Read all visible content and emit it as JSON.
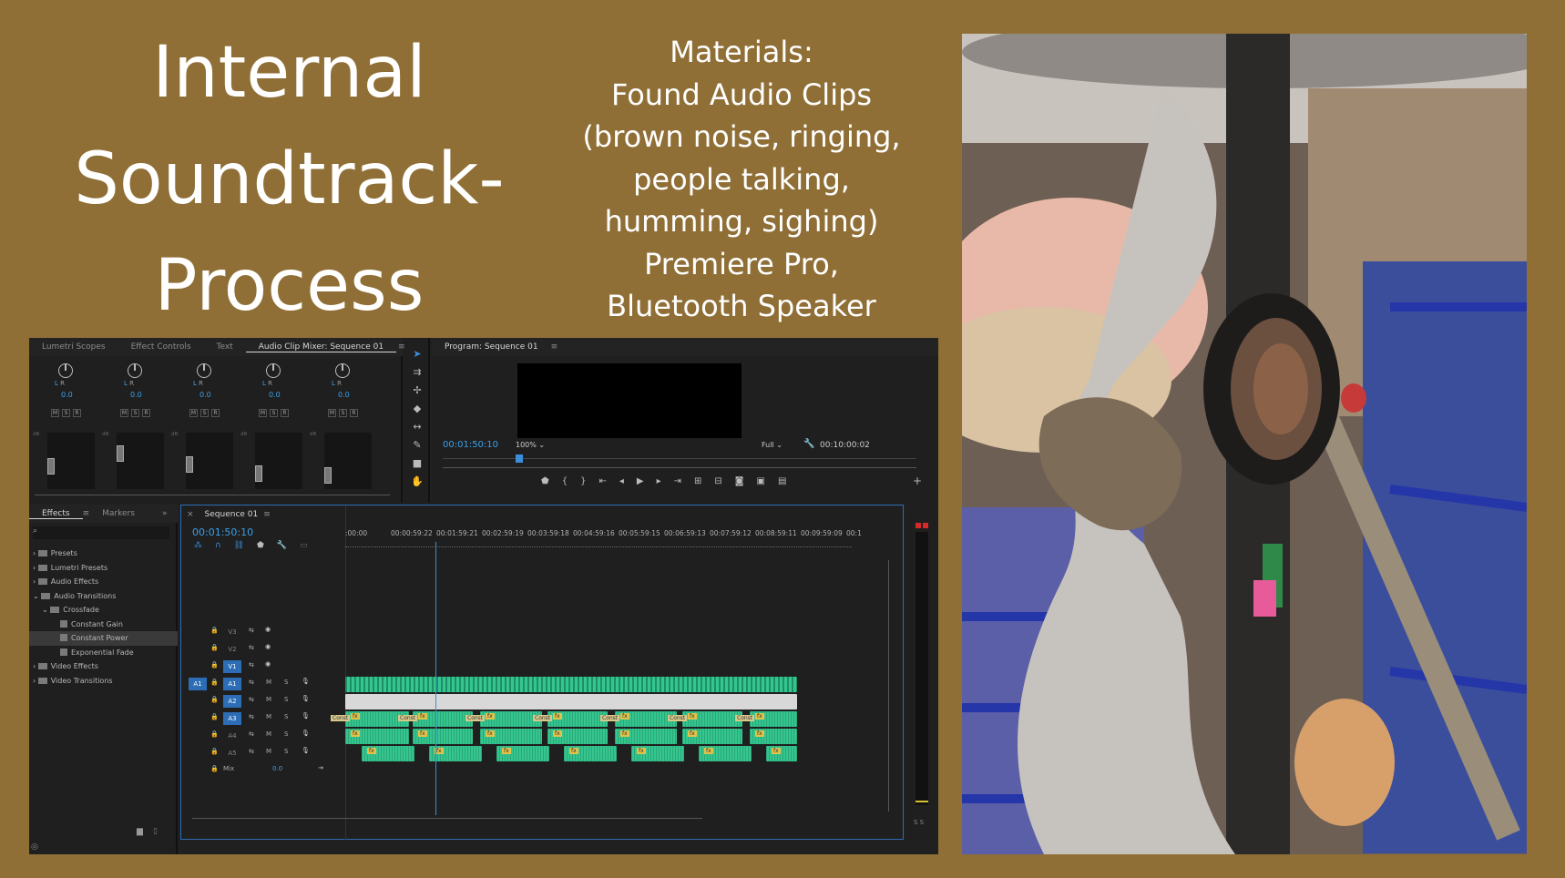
{
  "slide": {
    "title_lines": [
      "Internal",
      "Soundtrack-",
      "Process"
    ],
    "materials_lines": [
      "Materials:",
      "Found Audio Clips",
      "(brown noise, ringing,",
      "people talking,",
      "humming, sighing)",
      "Premiere Pro,",
      "Bluetooth Speaker"
    ],
    "background_color": "#8f6f36"
  },
  "premiere": {
    "top_tabs": [
      "Lumetri Scopes",
      "Effect Controls",
      "Text",
      "Audio Clip Mixer: Sequence 01"
    ],
    "menu_icon": "≡",
    "overflow_icon": "»",
    "mixer": {
      "channels": [
        {
          "lr": "L",
          "r": "R",
          "value": "0.0"
        },
        {
          "lr": "L",
          "r": "R",
          "value": "0.0"
        },
        {
          "lr": "L",
          "r": "R",
          "value": "0.0"
        },
        {
          "lr": "L",
          "r": "R",
          "value": "0.0"
        },
        {
          "lr": "L",
          "r": "R",
          "value": "0.0"
        }
      ],
      "msr": [
        "M",
        "S",
        "R"
      ],
      "db_label": "dB"
    },
    "program": {
      "title": "Program: Sequence 01",
      "timecode": "00:01:50:10",
      "zoom": "100%",
      "quality": "Full",
      "duration": "00:10:00:02"
    },
    "effects_panel": {
      "tabs": [
        "Effects",
        "Markers"
      ],
      "tree": [
        {
          "label": "Presets",
          "indent": 0
        },
        {
          "label": "Lumetri Presets",
          "indent": 0
        },
        {
          "label": "Audio Effects",
          "indent": 0
        },
        {
          "label": "Audio Transitions",
          "indent": 0
        },
        {
          "label": "Crossfade",
          "indent": 1
        },
        {
          "label": "Constant Gain",
          "indent": 2
        },
        {
          "label": "Constant Power",
          "indent": 2,
          "selected": true
        },
        {
          "label": "Exponential Fade",
          "indent": 2
        },
        {
          "label": "Video Effects",
          "indent": 0
        },
        {
          "label": "Video Transitions",
          "indent": 0
        }
      ]
    },
    "timeline": {
      "tab": "Sequence 01",
      "timecode": "00:01:50:10",
      "ruler": [
        ":00:00",
        "00:00:59:22",
        "00:01:59:21",
        "00:02:59:19",
        "00:03:59:18",
        "00:04:59:16",
        "00:05:59:15",
        "00:06:59:13",
        "00:07:59:12",
        "00:08:59:11",
        "00:09:59:09",
        "00:1"
      ],
      "video_tracks": [
        "V3",
        "V2",
        "V1"
      ],
      "audio_tracks": [
        "A1",
        "A2",
        "A3",
        "A4",
        "A5"
      ],
      "source_patch": "A1",
      "mix_label": "Mix",
      "mix_value": "0.0",
      "clip_label_const": "Const",
      "fx_badge": "fx",
      "meter_label": "S S"
    }
  }
}
